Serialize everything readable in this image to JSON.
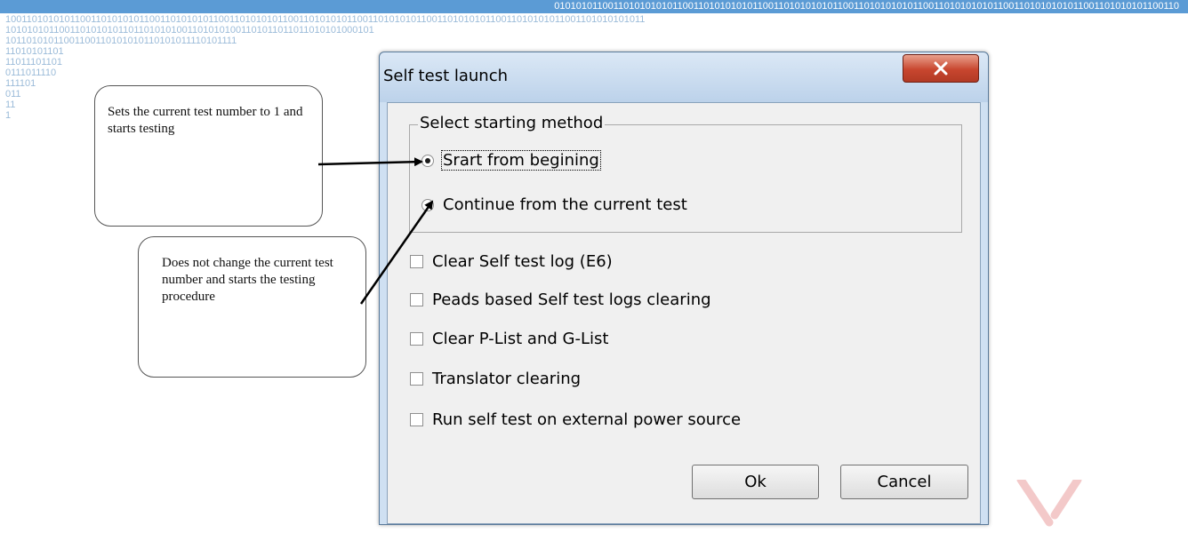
{
  "background": {
    "top_binary": "010101011001101010101011001101010101011001101010101011001101010101011001101010101011001101010101011001101010101100110",
    "lines": [
      "100110101010110011010101011001101010101100110101010110011010101011001101010101100110101010110011010101011001101010101011",
      "101010101100110101010110110101010011010101001101011011011010101000101",
      "10110101011001100110101010110101011110101111",
      "11010101101",
      "11011101101",
      "0111011110",
      "111101",
      "011",
      "11",
      "1"
    ],
    "accent_color": "#5b9bd5",
    "binary_text_color": "#9bbbd9"
  },
  "callouts": [
    {
      "text": "Sets the current test number to 1 and starts testing"
    },
    {
      "text": "Does not change the current test number and starts the testing procedure"
    }
  ],
  "dialog": {
    "title": "Self test launch",
    "close_icon": "close-x-icon",
    "group_title": "Select starting method",
    "radio_options": [
      {
        "label": "Srart from begining",
        "checked": true
      },
      {
        "label": "Continue from the current test",
        "checked": false
      }
    ],
    "checkboxes": [
      {
        "label": "Clear Self test log (E6)",
        "checked": false
      },
      {
        "label": "Peads based Self test logs clearing",
        "checked": false
      },
      {
        "label": "Clear P-List and G-List",
        "checked": false
      },
      {
        "label": "Translator clearing",
        "checked": false
      },
      {
        "label": "Run self test on external power source",
        "checked": false
      }
    ],
    "ok_label": "Ok",
    "cancel_label": "Cancel"
  }
}
